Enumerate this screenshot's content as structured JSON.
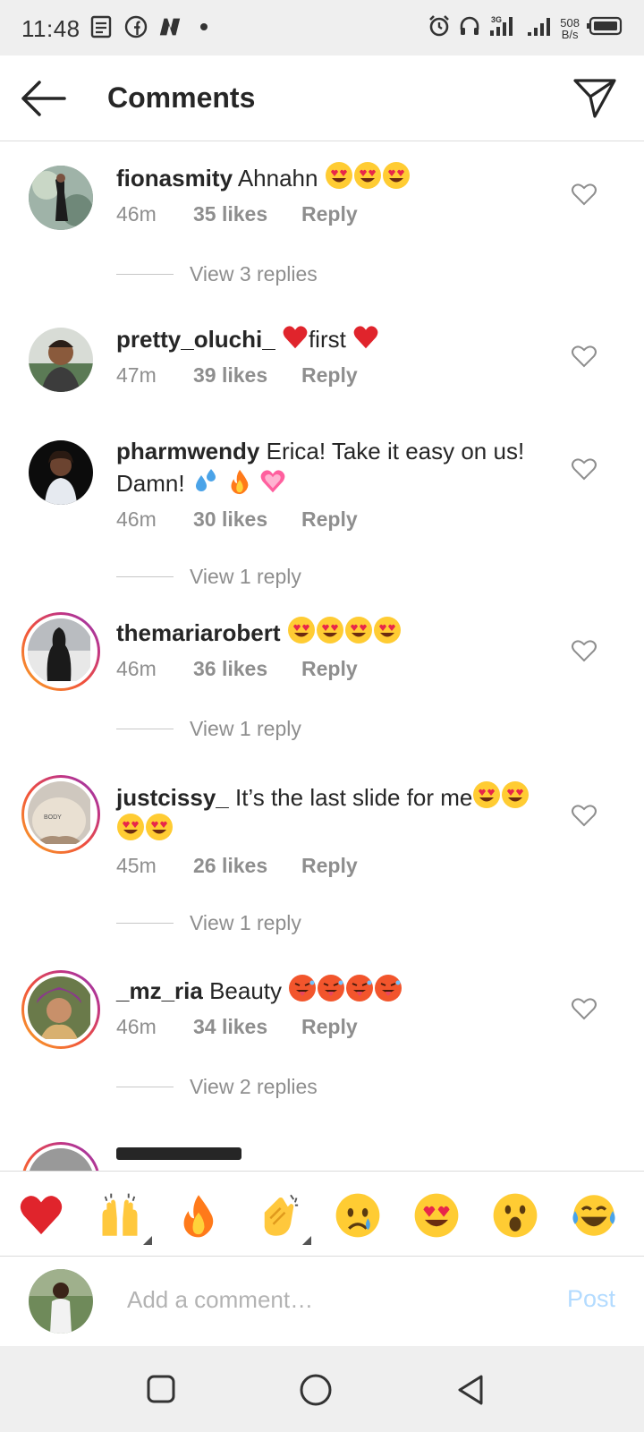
{
  "status_bar": {
    "time": "11:48",
    "network_speed": "508",
    "network_unit": "B/s",
    "network_type": "3G"
  },
  "header": {
    "title": "Comments",
    "back_icon": "arrow-left-icon",
    "send_icon": "paper-plane-icon"
  },
  "comments": [
    {
      "username": "fionasmity",
      "text": "Ahnahn",
      "emojis": [
        "heart-eyes",
        "heart-eyes",
        "heart-eyes"
      ],
      "time": "46m",
      "likes": "35 likes",
      "reply": "Reply",
      "view_replies": "View 3 replies",
      "story_ring": false
    },
    {
      "username": "pretty_oluchi_",
      "text": "first",
      "emojis": [],
      "time": "47m",
      "likes": "39 likes",
      "reply": "Reply",
      "story_ring": false
    },
    {
      "username": "pharmwendy",
      "text": "Erica! Take it easy on us! Damn!",
      "emojis": [
        "sweat-droplets",
        "fire",
        "pink-heart"
      ],
      "time": "46m",
      "likes": "30 likes",
      "reply": "Reply",
      "view_replies": "View 1 reply",
      "story_ring": false
    },
    {
      "username": "themariarobert",
      "text": "",
      "emojis": [
        "heart-eyes",
        "heart-eyes",
        "heart-eyes",
        "heart-eyes"
      ],
      "time": "46m",
      "likes": "36 likes",
      "reply": "Reply",
      "view_replies": "View 1 reply",
      "story_ring": true
    },
    {
      "username": "justcissy_",
      "text": "It’s the last slide for me",
      "emojis": [
        "heart-eyes",
        "heart-eyes",
        "heart-eyes",
        "heart-eyes"
      ],
      "avatar_text": "BODY",
      "time": "45m",
      "likes": "26 likes",
      "reply": "Reply",
      "view_replies": "View 1 reply",
      "story_ring": true
    },
    {
      "username": "_mz_ria",
      "text": "Beauty",
      "emojis": [
        "hot-face",
        "hot-face",
        "hot-face",
        "hot-face"
      ],
      "time": "46m",
      "likes": "34 likes",
      "reply": "Reply",
      "view_replies": "View 2 replies",
      "story_ring": true
    }
  ],
  "quick_emojis": [
    "red-heart",
    "raising-hands",
    "fire",
    "clapping-hands",
    "crying-face",
    "heart-eyes",
    "astonished-face",
    "tears-of-joy"
  ],
  "compose": {
    "placeholder": "Add a comment…",
    "post_label": "Post"
  },
  "nav_bar": {
    "icons": [
      "recents-square-icon",
      "home-circle-icon",
      "back-triangle-icon"
    ]
  }
}
